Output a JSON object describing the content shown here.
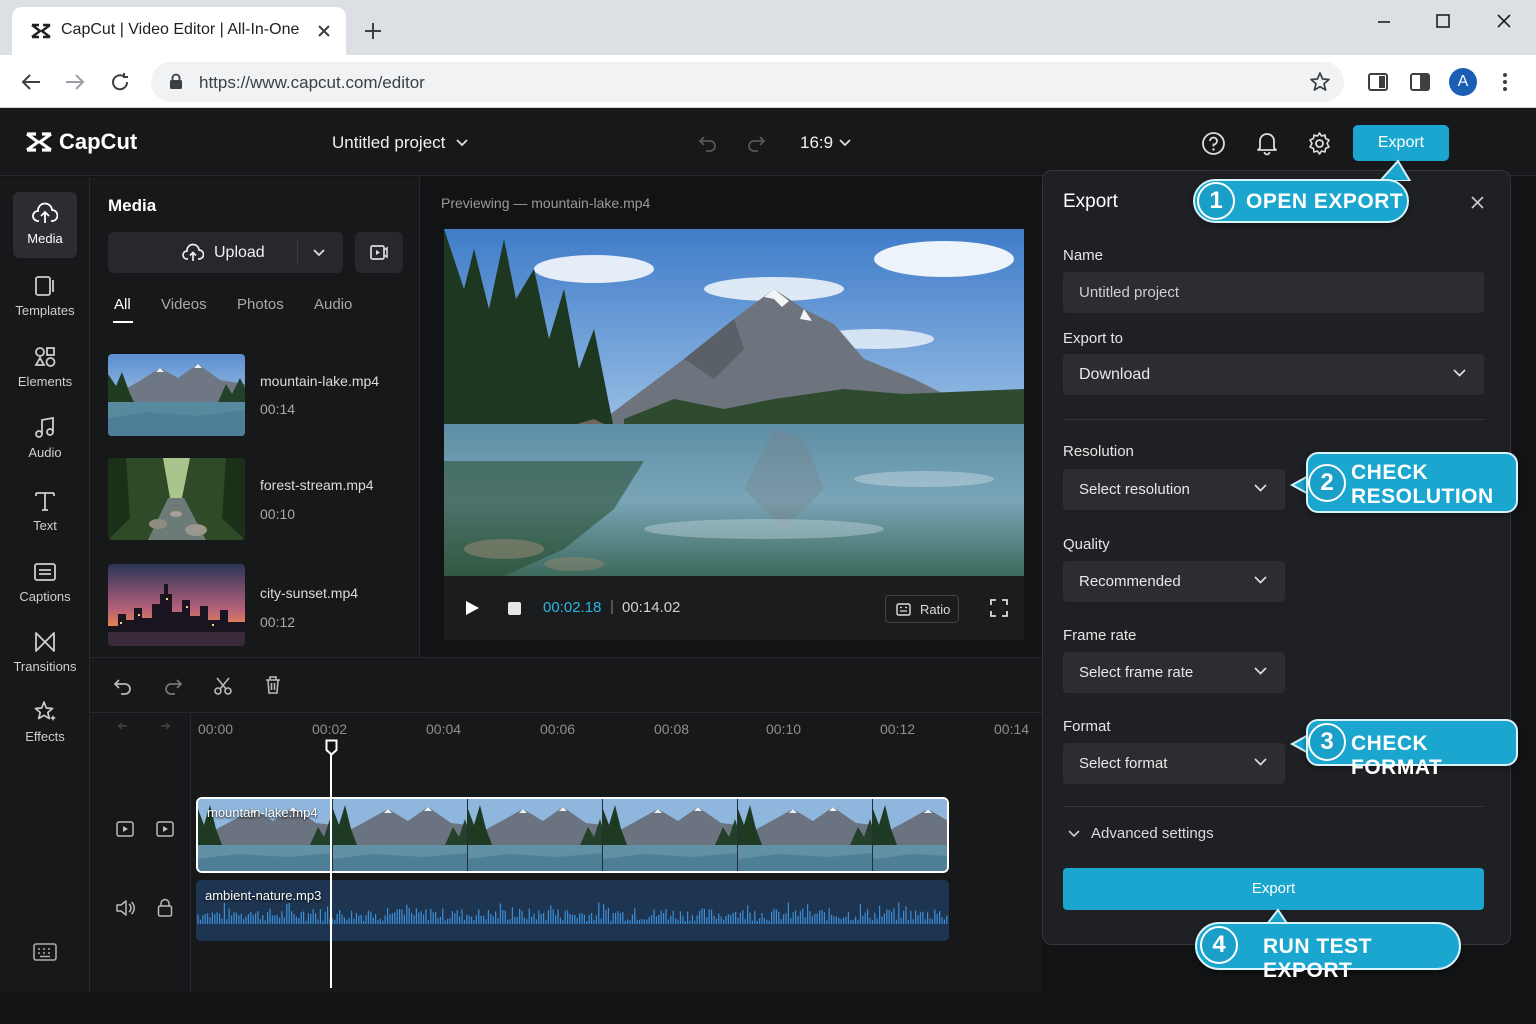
{
  "browser": {
    "tab_title": "CapCut | Video Editor | All-In-One",
    "url": "https://www.capcut.com/editor",
    "profile_initial": "A"
  },
  "header": {
    "brand": "CapCut",
    "project_name": "Untitled project",
    "aspect_ratio": "16:9",
    "export_label": "Export"
  },
  "rail": {
    "items": [
      {
        "label": "Media",
        "icon": "cloud-upload-icon"
      },
      {
        "label": "Templates",
        "icon": "templates-icon"
      },
      {
        "label": "Elements",
        "icon": "elements-icon"
      },
      {
        "label": "Audio",
        "icon": "music-note-icon"
      },
      {
        "label": "Text",
        "icon": "text-icon"
      },
      {
        "label": "Captions",
        "icon": "captions-icon"
      },
      {
        "label": "Transitions",
        "icon": "transitions-icon"
      },
      {
        "label": "Effects",
        "icon": "effects-star-icon"
      }
    ]
  },
  "media": {
    "title": "Media",
    "upload_label": "Upload",
    "tabs": [
      "All",
      "Videos",
      "Photos",
      "Audio"
    ],
    "items": [
      {
        "name": "mountain-lake.mp4",
        "duration": "00:14"
      },
      {
        "name": "forest-stream.mp4",
        "duration": "00:10"
      },
      {
        "name": "city-sunset.mp4",
        "duration": "00:12"
      }
    ]
  },
  "preview": {
    "caption": "Previewing — mountain-lake.mp4",
    "current_time": "00:02.18",
    "separator": "|",
    "total_time": "00:14.02",
    "ratio_label": "Ratio"
  },
  "timeline": {
    "ticks": [
      "00:00",
      "00:02",
      "00:04",
      "00:06",
      "00:08",
      "00:10",
      "00:12",
      "00:14"
    ],
    "video_clip": "mountain-lake.mp4",
    "audio_clip": "ambient-nature.mp3"
  },
  "export_panel": {
    "title": "Export",
    "name_label": "Name",
    "name_value": "Untitled project",
    "export_to_label": "Export to",
    "export_to_value": "Download",
    "resolution_label": "Resolution",
    "resolution_value": "Select resolution",
    "quality_label": "Quality",
    "quality_value": "Recommended",
    "frame_rate_label": "Frame rate",
    "frame_rate_value": "Select frame rate",
    "format_label": "Format",
    "format_value": "Select format",
    "advanced_label": "Advanced settings",
    "export_button": "Export"
  },
  "callouts": [
    {
      "num": "1",
      "text": "OPEN EXPORT"
    },
    {
      "num": "2",
      "text_line1": "CHECK",
      "text_line2": "RESOLUTION"
    },
    {
      "num": "3",
      "text": "CHECK FORMAT"
    },
    {
      "num": "4",
      "text": "RUN TEST EXPORT"
    }
  ],
  "colors": {
    "accent": "#1aa6cf",
    "timecode": "#2bb6e0",
    "panel_bg": "#1f2023",
    "app_bg": "#121314"
  }
}
